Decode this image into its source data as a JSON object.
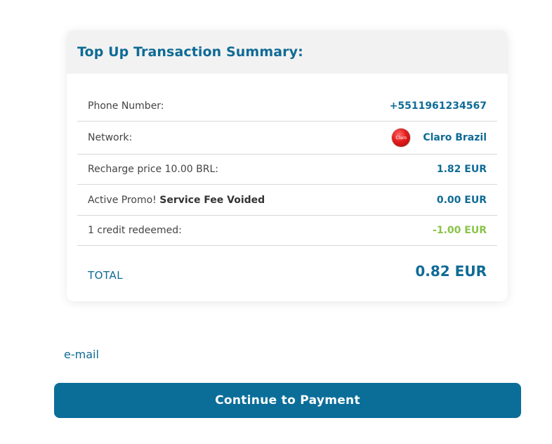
{
  "summary": {
    "title": "Top Up Transaction Summary:",
    "rows": [
      {
        "label": "Phone Number:",
        "value": "+5511961234567"
      },
      {
        "label": "Network:",
        "value": "Claro Brazil",
        "logo_text": "Claro",
        "logo_icon": "claro-logo-icon"
      },
      {
        "label": "Recharge price 10.00 BRL:",
        "value": "1.82 EUR"
      },
      {
        "label_prefix": "Active Promo! ",
        "label_bold": "Service Fee Voided",
        "value": "0.00 EUR"
      },
      {
        "label": "1 credit redeemed:",
        "value": "-1.00 EUR"
      }
    ],
    "total_label": "TOTAL",
    "total_value": "0.82 EUR"
  },
  "form": {
    "email_label": "e-mail",
    "continue_button": "Continue to Payment"
  },
  "colors": {
    "primary": "#0f6b96",
    "button": "#0a6e99",
    "credit_green": "#8bc34a",
    "header_bg": "#f2f2f2"
  }
}
